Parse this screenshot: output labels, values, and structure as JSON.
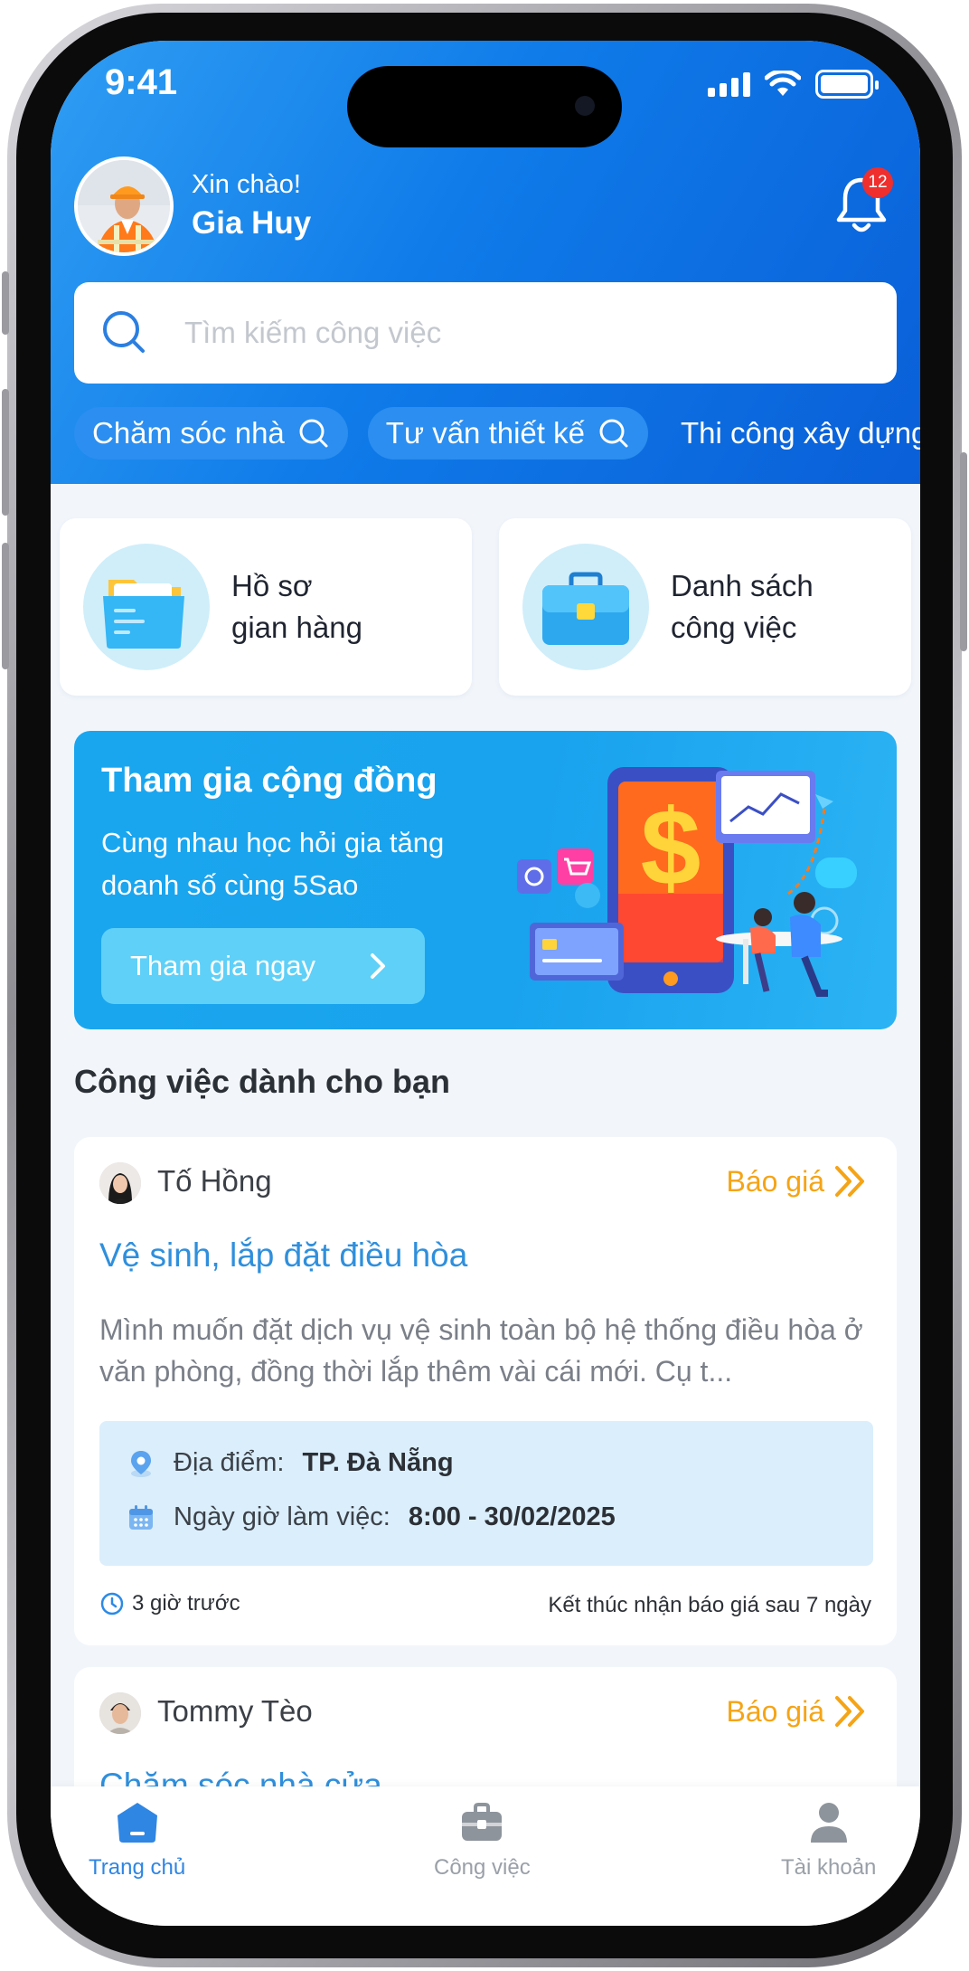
{
  "status_bar": {
    "time": "9:41"
  },
  "header": {
    "greeting": "Xin chào!",
    "user_name": "Gia Huy",
    "notification_count": "12"
  },
  "search": {
    "placeholder": "Tìm kiếm công việc"
  },
  "chips": [
    "Chăm sóc nhà",
    "Tư vấn thiết kế",
    "Thi công xây dựng"
  ],
  "quick_actions": [
    {
      "line1": "Hồ sơ",
      "line2": "gian hàng"
    },
    {
      "line1": "Danh sách",
      "line2": "công việc"
    }
  ],
  "banner": {
    "title": "Tham gia cộng đồng",
    "description": "Cùng nhau học hỏi gia tăng doanh số cùng 5Sao",
    "button_label": "Tham gia ngay"
  },
  "section_title": "Công việc dành cho bạn",
  "jobs": [
    {
      "poster": "Tố Hồng",
      "quote_label": "Báo giá",
      "title": "Vệ sinh, lắp đặt điều hòa",
      "description": "Mình muốn đặt dịch vụ vệ sinh toàn bộ hệ thống điều hòa ở văn phòng, đồng thời lắp thêm vài cái mới. Cụ t...",
      "location_label": "Địa điểm:",
      "location": "TP. Đà Nẵng",
      "time_label": "Ngày giờ làm việc:",
      "time": "8:00 - 30/02/2025",
      "posted": "3 giờ trước",
      "deadline": "Kết thúc nhận báo giá sau 7 ngày"
    },
    {
      "poster": "Tommy Tèo",
      "quote_label": "Báo giá",
      "title": "Chăm sóc nhà cửa"
    }
  ],
  "tabs": [
    {
      "label": "Trang chủ",
      "active": true
    },
    {
      "label": "Công việc",
      "active": false
    },
    {
      "label": "Tài khoản",
      "active": false
    }
  ],
  "colors": {
    "primary": "#0f7be9",
    "accent_orange": "#f5a416",
    "job_title": "#2f8fdc",
    "banner": "#1aa6ef"
  }
}
